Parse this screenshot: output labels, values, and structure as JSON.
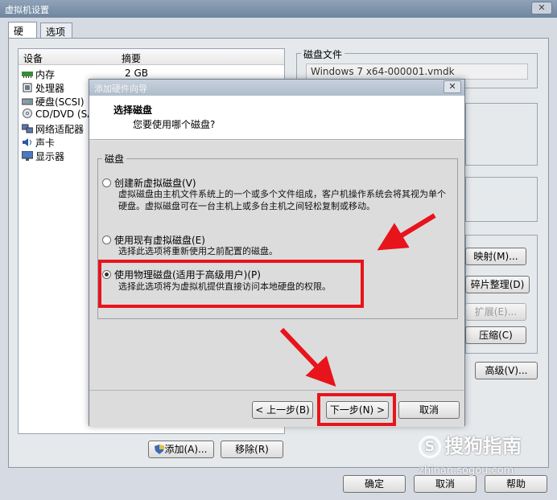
{
  "window": {
    "title": "虚拟机设置",
    "close": "✕"
  },
  "tabs": [
    {
      "label": "硬件"
    },
    {
      "label": "选项"
    }
  ],
  "device_table": {
    "headers": {
      "device": "设备",
      "summary": "摘要"
    },
    "rows": [
      {
        "name": "内存",
        "summary": "2 GB",
        "icon": "memory-icon"
      },
      {
        "name": "处理器",
        "summary": "",
        "icon": "cpu-icon"
      },
      {
        "name": "硬盘(SCSI)",
        "summary": "",
        "icon": "harddisk-icon"
      },
      {
        "name": "CD/DVD (SA",
        "summary": "",
        "icon": "cdrom-icon"
      },
      {
        "name": "网络适配器",
        "summary": "",
        "icon": "network-icon"
      },
      {
        "name": "声卡",
        "summary": "",
        "icon": "sound-icon"
      },
      {
        "name": "显示器",
        "summary": "",
        "icon": "display-icon"
      }
    ]
  },
  "disk_file": {
    "label": "磁盘文件",
    "value": "Windows 7 x64-000001.vmdk"
  },
  "right_buttons": {
    "map": "映射(M)...",
    "defrag": "碎片整理(D)",
    "expand": "扩展(E)...",
    "compact": "压缩(C)",
    "advanced": "高级(V)..."
  },
  "list_buttons": {
    "add": "添加(A)...",
    "remove": "移除(R)"
  },
  "bottom_buttons": {
    "ok": "确定",
    "cancel": "取消",
    "help": "帮助"
  },
  "wizard": {
    "title": "添加硬件向导",
    "close": "✕",
    "header_title": "选择磁盘",
    "header_subtitle": "您要使用哪个磁盘?",
    "group_label": "磁盘",
    "options": [
      {
        "label": "创建新虚拟磁盘(V)",
        "desc": "虚拟磁盘由主机文件系统上的一个或多个文件组成，客户机操作系统会将其视为单个硬盘。虚拟磁盘可在一台主机上或多台主机之间轻松复制或移动。",
        "checked": false
      },
      {
        "label": "使用现有虚拟磁盘(E)",
        "desc": "选择此选项将重新使用之前配置的磁盘。",
        "checked": false
      },
      {
        "label": "使用物理磁盘(适用于高级用户)(P)",
        "desc": "选择此选项将为虚拟机提供直接访问本地硬盘的权限。",
        "checked": true
      }
    ],
    "buttons": {
      "back": "< 上一步(B)",
      "next": "下一步(N) >",
      "cancel": "取消"
    }
  },
  "watermark": {
    "brand": "搜狗指南",
    "logo": "S",
    "url": "zhinan.sogou.com"
  },
  "colors": {
    "annotation_red": "#e8141b"
  }
}
